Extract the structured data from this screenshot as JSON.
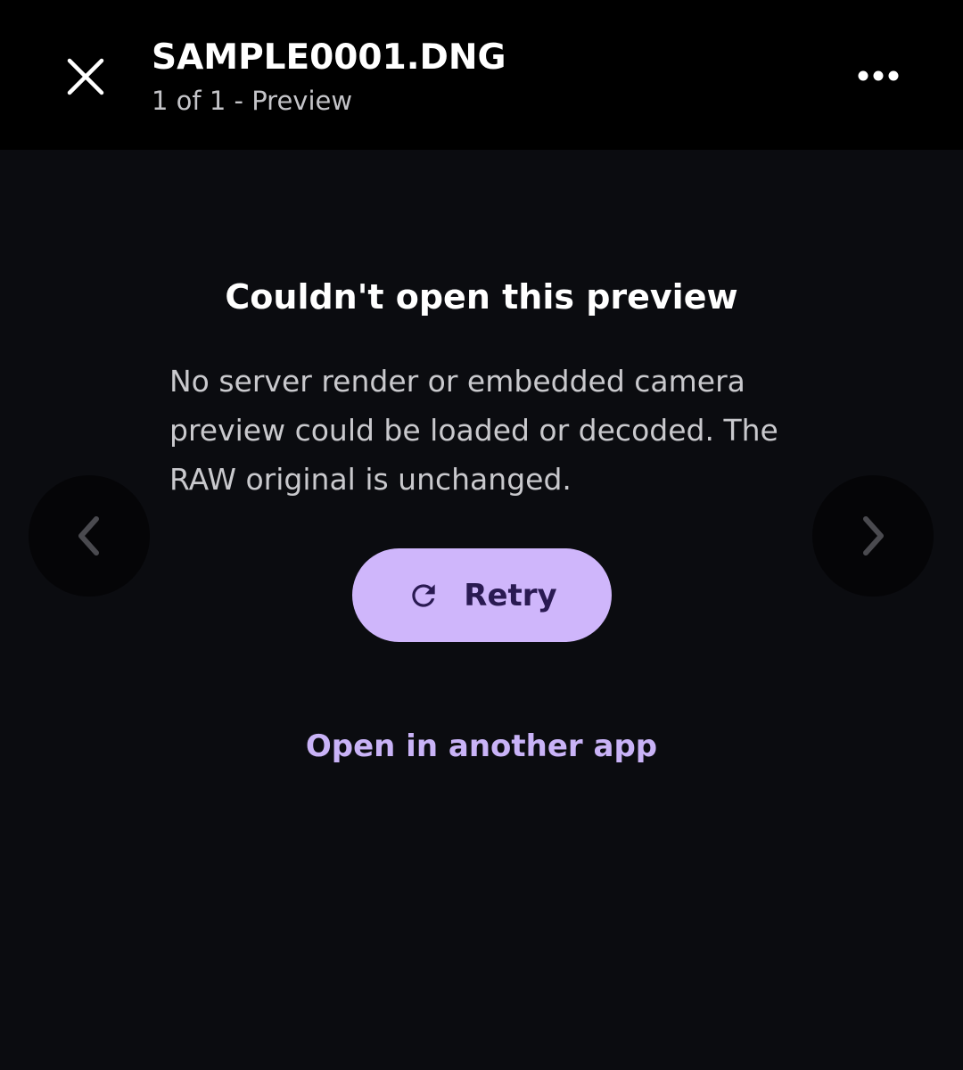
{
  "header": {
    "title": "SAMPLE0001.DNG",
    "subtitle": "1 of 1 - Preview",
    "close_icon": "close-icon",
    "more_icon": "more-horizontal-icon"
  },
  "navigation": {
    "prev_icon": "chevron-left-icon",
    "next_icon": "chevron-right-icon"
  },
  "error": {
    "title": "Couldn't open this preview",
    "message": "No server render or embedded camera preview could be loaded or decoded. The RAW original is unchanged."
  },
  "actions": {
    "retry_label": "Retry",
    "retry_icon": "refresh-icon",
    "open_other_label": "Open in another app"
  },
  "colors": {
    "background": "#0b0c10",
    "header_background": "#000000",
    "accent": "#cfb6fb",
    "accent_text": "#c9b3f7",
    "button_text": "#2a1a52"
  }
}
